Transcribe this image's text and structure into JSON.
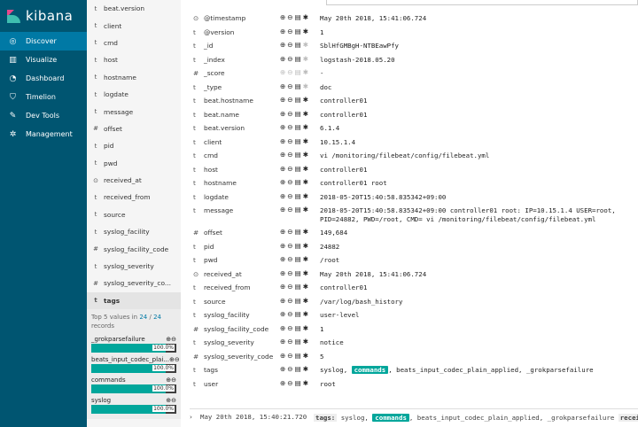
{
  "brand": "kibana",
  "nav": [
    {
      "label": "Discover",
      "icon": "compass-icon",
      "glyph": "◎",
      "active": true
    },
    {
      "label": "Visualize",
      "icon": "bar-chart-icon",
      "glyph": "▥",
      "active": false
    },
    {
      "label": "Dashboard",
      "icon": "dashboard-icon",
      "glyph": "◔",
      "active": false
    },
    {
      "label": "Timelion",
      "icon": "shield-icon",
      "glyph": "⛉",
      "active": false
    },
    {
      "label": "Dev Tools",
      "icon": "wrench-icon",
      "glyph": "✎",
      "active": false
    },
    {
      "label": "Management",
      "icon": "gear-icon",
      "glyph": "✲",
      "active": false
    }
  ],
  "fields_top": [
    {
      "type": "t",
      "name": "beat.version"
    },
    {
      "type": "t",
      "name": "client"
    },
    {
      "type": "t",
      "name": "cmd"
    },
    {
      "type": "t",
      "name": "host"
    },
    {
      "type": "t",
      "name": "hostname"
    },
    {
      "type": "t",
      "name": "logdate"
    },
    {
      "type": "t",
      "name": "message"
    },
    {
      "type": "#",
      "name": "offset"
    },
    {
      "type": "t",
      "name": "pid"
    },
    {
      "type": "t",
      "name": "pwd"
    },
    {
      "type": "⊙",
      "name": "received_at"
    },
    {
      "type": "t",
      "name": "received_from"
    },
    {
      "type": "t",
      "name": "source"
    },
    {
      "type": "t",
      "name": "syslog_facility"
    },
    {
      "type": "#",
      "name": "syslog_facility_code"
    },
    {
      "type": "t",
      "name": "syslog_severity"
    },
    {
      "type": "#",
      "name": "syslog_severity_co..."
    }
  ],
  "selected_field": {
    "type": "t",
    "name": "tags"
  },
  "details": {
    "prefix": "Top 5 values in ",
    "count": "24",
    "sep": " / ",
    "total": "24",
    "suffix": "records",
    "buckets": [
      {
        "label": "_grokparsefailure",
        "pct": "100.0%",
        "fraction": 1.0
      },
      {
        "label": "beats_input_codec_plai...",
        "pct": "100.0%",
        "fraction": 1.0
      },
      {
        "label": "commands",
        "pct": "100.0%",
        "fraction": 1.0
      },
      {
        "label": "syslog",
        "pct": "100.0%",
        "fraction": 1.0
      }
    ]
  },
  "fields_bottom": [
    {
      "type": "t",
      "name": "user"
    }
  ],
  "doc_rows": [
    {
      "type": "⊙",
      "name": "@timestamp",
      "value": "May 20th 2018, 15:41:06.724",
      "dim": false
    },
    {
      "type": "t",
      "name": "@version",
      "value": "1",
      "dim": false
    },
    {
      "type": "t",
      "name": "_id",
      "value": "SblHfGMBgH-NTBEawPfy",
      "dim": true
    },
    {
      "type": "t",
      "name": "_index",
      "value": "logstash-2018.05.20",
      "dim": true
    },
    {
      "type": "#",
      "name": "_score",
      "value": "-",
      "dim": true,
      "alldim": true
    },
    {
      "type": "t",
      "name": "_type",
      "value": "doc",
      "dim": true
    },
    {
      "type": "t",
      "name": "beat.hostname",
      "value": "controller01",
      "dim": false
    },
    {
      "type": "t",
      "name": "beat.name",
      "value": "controller01",
      "dim": false
    },
    {
      "type": "t",
      "name": "beat.version",
      "value": "6.1.4",
      "dim": false
    },
    {
      "type": "t",
      "name": "client",
      "value": "10.15.1.4",
      "dim": false
    },
    {
      "type": "t",
      "name": "cmd",
      "value": " vi /monitoring/filebeat/config/filebeat.yml",
      "dim": false
    },
    {
      "type": "t",
      "name": "host",
      "value": "controller01",
      "dim": false
    },
    {
      "type": "t",
      "name": "hostname",
      "value": "controller01 root",
      "dim": false
    },
    {
      "type": "t",
      "name": "logdate",
      "value": "2018-05-20T15:40:58.835342+09:00",
      "dim": false
    },
    {
      "type": "t",
      "name": "message",
      "value": "2018-05-20T15:40:58.835342+09:00 controller01 root: IP=10.15.1.4 USER=root, PID=24882, PWD=/root, CMD= vi /monitoring/filebeat/config/filebeat.yml",
      "dim": false,
      "tall": true
    },
    {
      "type": "#",
      "name": "offset",
      "value": "149,684",
      "dim": false
    },
    {
      "type": "t",
      "name": "pid",
      "value": "24882",
      "dim": false
    },
    {
      "type": "t",
      "name": "pwd",
      "value": "/root",
      "dim": false
    },
    {
      "type": "⊙",
      "name": "received_at",
      "value": "May 20th 2018, 15:41:06.724",
      "dim": false
    },
    {
      "type": "t",
      "name": "received_from",
      "value": "controller01",
      "dim": false
    },
    {
      "type": "t",
      "name": "source",
      "value": "/var/log/bash_history",
      "dim": false
    },
    {
      "type": "t",
      "name": "syslog_facility",
      "value": "user-level",
      "dim": false
    },
    {
      "type": "#",
      "name": "syslog_facility_code",
      "value": "1",
      "dim": false
    },
    {
      "type": "t",
      "name": "syslog_severity",
      "value": "notice",
      "dim": false
    },
    {
      "type": "#",
      "name": "syslog_severity_code",
      "value": "5",
      "dim": false
    },
    {
      "type": "t",
      "name": "tags",
      "value": "",
      "dim": false,
      "tags": true
    },
    {
      "type": "t",
      "name": "user",
      "value": "root",
      "dim": false
    }
  ],
  "tags_value": {
    "a": "syslog, ",
    "b": "commands",
    "c": ", beats_input_codec_plain_applied, _grokparsefailure"
  },
  "bottom": {
    "chevron": "›",
    "time": "May 20th 2018, 15:40:21.720",
    "src_key": "tags:",
    "src_a": " syslog, ",
    "src_b": "commands",
    "src_c": ", beats_input_codec_plain_applied, _grokparsefailure ",
    "src_key2": "received_fro"
  }
}
